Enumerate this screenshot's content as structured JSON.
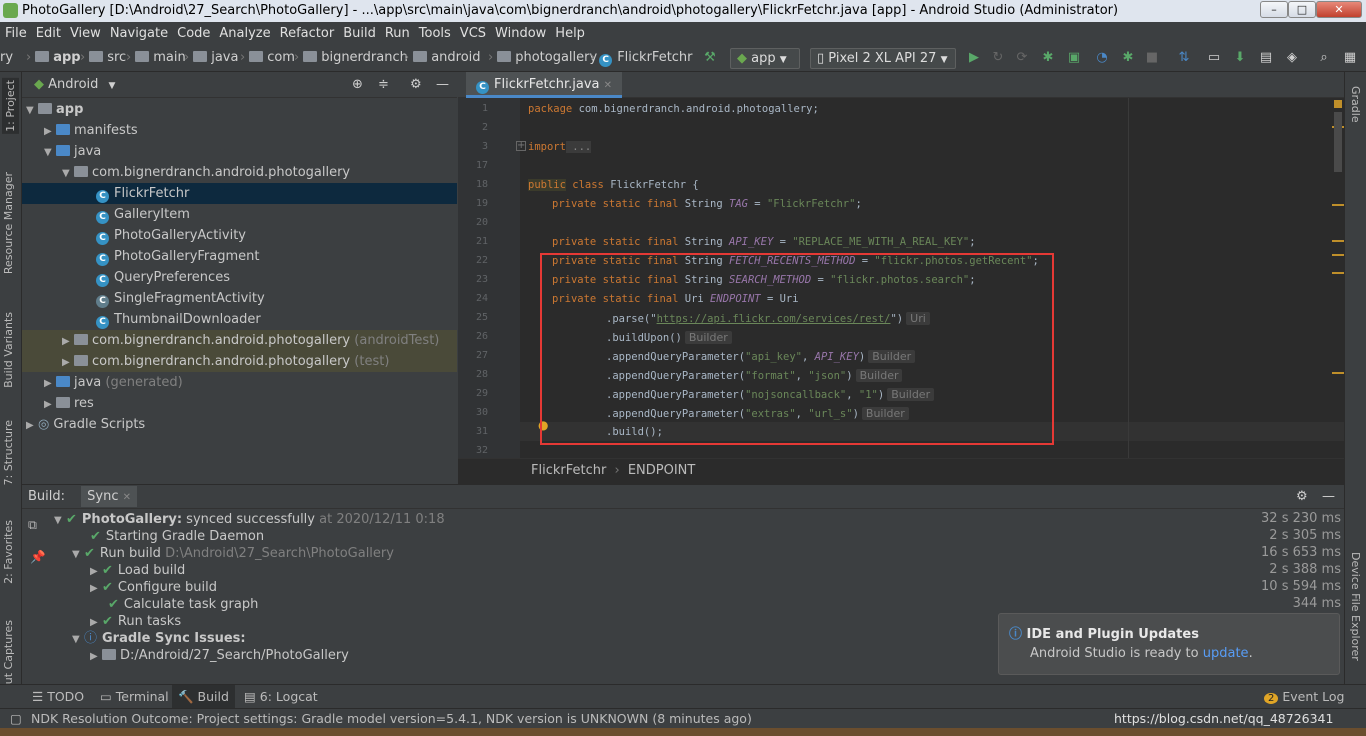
{
  "window": {
    "title": "PhotoGallery [D:\\Android\\27_Search\\PhotoGallery] - ...\\app\\src\\main\\java\\com\\bignerdranch\\android\\photogallery\\FlickrFetchr.java [app] - Android Studio (Administrator)",
    "minimize": "–",
    "maximize": "□",
    "close": "✕"
  },
  "menu": [
    "File",
    "Edit",
    "View",
    "Navigate",
    "Code",
    "Analyze",
    "Refactor",
    "Build",
    "Run",
    "Tools",
    "VCS",
    "Window",
    "Help"
  ],
  "nav": {
    "crumbs": [
      "ry",
      "app",
      "src",
      "main",
      "java",
      "com",
      "bignerdranch",
      "android",
      "photogallery",
      "FlickrFetchr"
    ],
    "run_config": "app",
    "device": "Pixel 2 XL API 27"
  },
  "left_tabs": [
    "1: Project",
    "Resource Manager",
    "Build Variants",
    "7: Structure",
    "2: Favorites",
    "out Captures"
  ],
  "right_tabs": [
    "Gradle",
    "Device File Explorer"
  ],
  "project": {
    "view": "Android",
    "tree": [
      {
        "label": "app",
        "suffix": ""
      },
      {
        "label": "manifests",
        "suffix": ""
      },
      {
        "label": "java",
        "suffix": ""
      },
      {
        "label": "com.bignerdranch.android.photogallery",
        "suffix": ""
      },
      {
        "label": "FlickrFetchr",
        "suffix": ""
      },
      {
        "label": "GalleryItem",
        "suffix": ""
      },
      {
        "label": "PhotoGalleryActivity",
        "suffix": ""
      },
      {
        "label": "PhotoGalleryFragment",
        "suffix": ""
      },
      {
        "label": "QueryPreferences",
        "suffix": ""
      },
      {
        "label": "SingleFragmentActivity",
        "suffix": ""
      },
      {
        "label": "ThumbnailDownloader",
        "suffix": ""
      },
      {
        "label": "com.bignerdranch.android.photogallery",
        "suffix": "(androidTest)"
      },
      {
        "label": "com.bignerdranch.android.photogallery",
        "suffix": "(test)"
      },
      {
        "label": "java",
        "suffix": "(generated)"
      },
      {
        "label": "res",
        "suffix": ""
      },
      {
        "label": "Gradle Scripts",
        "suffix": ""
      }
    ]
  },
  "editor": {
    "tab": "FlickrFetchr.java",
    "line_numbers": [
      "1",
      "2",
      "3",
      "17",
      "18",
      "19",
      "20",
      "21",
      "22",
      "23",
      "24",
      "25",
      "26",
      "27",
      "28",
      "29",
      "30",
      "31",
      "32"
    ],
    "lines": {
      "l1_kw": "package",
      "l1": " com.bignerdranch.android.photogallery;",
      "l3_kw": "import",
      "l3": " ...",
      "l18_kw1": "public",
      "l18_kw2": " class",
      "l18": " FlickrFetchr {",
      "mod": "private static final",
      "t_string": " String ",
      "t_uri": " Uri ",
      "tag_name": "TAG",
      "tag_val": "\"FlickrFetchr\"",
      "api_name": "API_KEY",
      "api_val": "\"REPLACE_ME_WITH_A_REAL_KEY\"",
      "fr_name": "FETCH_RECENTS_METHOD",
      "fr_val": "\"flickr.photos.getRecent\"",
      "sm_name": "SEARCH_METHOD",
      "sm_val": "\"flickr.photos.search\"",
      "ep_name": "ENDPOINT",
      "ep_rest": " = Uri",
      "parse_pre": ".parse(\"",
      "parse_url": "https://api.flickr.com/services/rest/",
      "parse_post": "\")",
      "buildupon": ".buildUpon()",
      "aqp": ".appendQueryParameter(",
      "k1": "\"api_key\"",
      "v1": "API_KEY",
      "k2": "\"format\"",
      "v2": "\"json\"",
      "k3": "\"nojsoncallback\"",
      "v3": "\"1\"",
      "k4": "\"extras\"",
      "v4": "\"url_s\"",
      "build": ".build();",
      "hint_uri": "Uri",
      "hint_builder": "Builder"
    },
    "breadcrumb": [
      "FlickrFetchr",
      "ENDPOINT"
    ]
  },
  "build": {
    "label": "Build:",
    "tab": "Sync",
    "rows": [
      {
        "text": "PhotoGallery:",
        "extra": "synced successfully",
        "muted": "at 2020/12/11 0:18",
        "time": "32 s 230 ms"
      },
      {
        "text": "Starting Gradle Daemon",
        "time": "2 s 305 ms"
      },
      {
        "text": "Run build",
        "muted": "D:\\Android\\27_Search\\PhotoGallery",
        "time": "16 s 653 ms"
      },
      {
        "text": "Load build",
        "time": "2 s 388 ms"
      },
      {
        "text": "Configure build",
        "time": "10 s 594 ms"
      },
      {
        "text": "Calculate task graph",
        "time": "344 ms"
      },
      {
        "text": "Run tasks",
        "time": ""
      },
      {
        "text": "Gradle Sync Issues:",
        "time": ""
      },
      {
        "text": "D:/Android/27_Search/PhotoGallery",
        "time": ""
      }
    ]
  },
  "notification": {
    "title": "IDE and Plugin Updates",
    "body": "Android Studio is ready to",
    "link": "update",
    "tail": "."
  },
  "bottom_tabs": [
    "TODO",
    "Terminal",
    "Build",
    "6: Logcat",
    "Event Log"
  ],
  "event_count": "2",
  "status": "NDK Resolution Outcome: Project settings: Gradle model version=5.4.1, NDK version is UNKNOWN (8 minutes ago)",
  "watermark": "https://blog.csdn.net/qq_48726341"
}
